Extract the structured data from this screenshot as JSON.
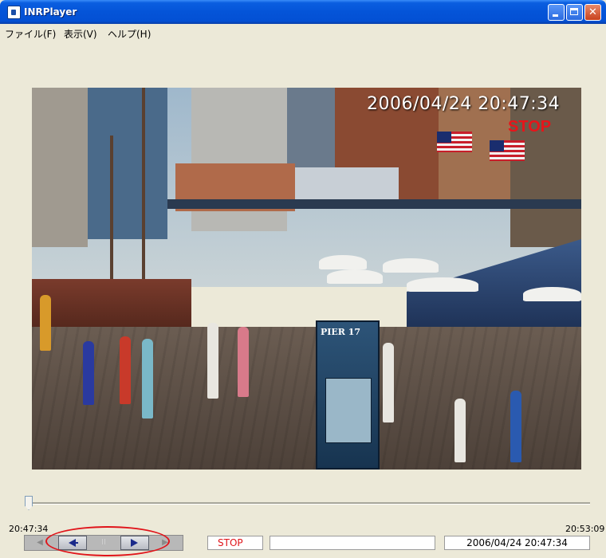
{
  "window": {
    "title": "INRPlayer"
  },
  "menu": {
    "file": "ファイル(F)",
    "view": "表示(V)",
    "help": "ヘルプ(H)"
  },
  "video": {
    "timestamp": "2006/04/24 20:47:34",
    "status_overlay": "STOP",
    "sign_text": "PIER 17"
  },
  "timeline": {
    "start_time": "20:47:34",
    "end_time": "20:53:09",
    "position": 0.0
  },
  "transport": {
    "prev_end": "◀",
    "pause": "II",
    "next_end": "▶"
  },
  "status": {
    "state": "STOP",
    "message": "",
    "datetime": "2006/04/24 20:47:34"
  },
  "colors": {
    "title_bar": "#0454d8",
    "stop_red": "#e8141a",
    "window_bg": "#ece9d8"
  }
}
